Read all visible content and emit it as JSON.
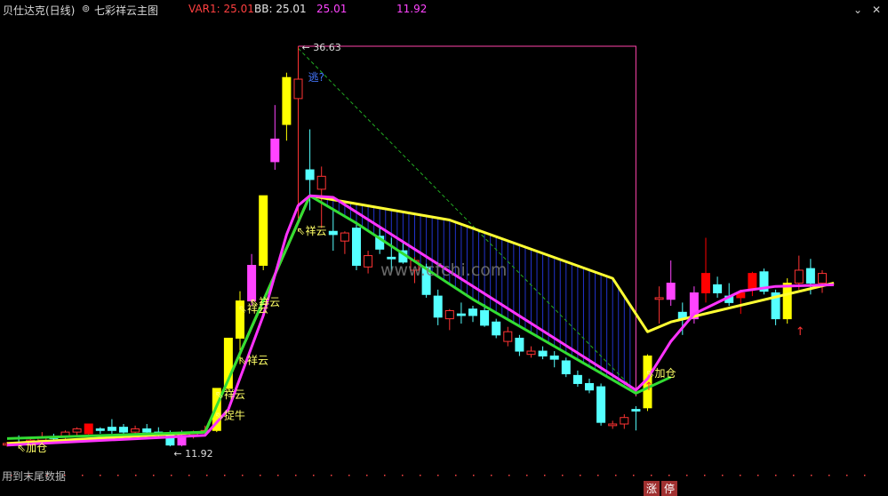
{
  "header": {
    "stock_label": "贝仕达克(日线)",
    "indicator_label": "七彩祥云主图",
    "var1_label": "VAR1: 25.01",
    "bb_label": "BB: 25.01",
    "plain_value": "25.01",
    "low_value": "11.92",
    "indicator_menu_icon": "circle-dropdown-icon",
    "settings_icon": "chevron-down-circle-icon",
    "close_icon": "close-x-icon",
    "colors": {
      "stock": "#d8d8d8",
      "var1": "#ff4040",
      "bb": "#e8e8e8",
      "value": "#ff44ff"
    }
  },
  "footer": {
    "hint_text": "用到末尾数据",
    "zhang_label": "涨",
    "ting_label": "停"
  },
  "watermark": "www.cfchi.com",
  "chart_data": {
    "type": "candlestick",
    "title": "七彩祥云主图",
    "ylim": [
      10.5,
      38.5
    ],
    "high_price": "36.63",
    "low_price": "11.92",
    "candles": [
      {
        "o": 12.0,
        "h": 12.2,
        "l": 11.9,
        "c": 12.1,
        "col": "#ff3333",
        "fill": false
      },
      {
        "o": 12.1,
        "h": 12.6,
        "l": 11.9,
        "c": 12.0,
        "col": "#55ffff",
        "fill": true
      },
      {
        "o": 12.0,
        "h": 12.4,
        "l": 11.9,
        "c": 12.3,
        "col": "#ff3333",
        "fill": false
      },
      {
        "o": 12.3,
        "h": 12.8,
        "l": 12.0,
        "c": 12.5,
        "col": "#ff3333",
        "fill": false
      },
      {
        "o": 12.4,
        "h": 12.7,
        "l": 12.1,
        "c": 12.5,
        "col": "#55ffff",
        "fill": true
      },
      {
        "o": 12.5,
        "h": 12.9,
        "l": 12.3,
        "c": 12.8,
        "col": "#ff3333",
        "fill": false
      },
      {
        "o": 12.8,
        "h": 13.1,
        "l": 12.6,
        "c": 13.0,
        "col": "#ff3333",
        "fill": false
      },
      {
        "o": 12.7,
        "h": 13.3,
        "l": 12.5,
        "c": 13.3,
        "col": "#ff0000",
        "fill": true
      },
      {
        "o": 13.0,
        "h": 13.1,
        "l": 12.7,
        "c": 12.9,
        "col": "#55ffff",
        "fill": true
      },
      {
        "o": 12.9,
        "h": 13.6,
        "l": 12.7,
        "c": 13.1,
        "col": "#55ffff",
        "fill": true
      },
      {
        "o": 13.1,
        "h": 13.3,
        "l": 12.6,
        "c": 12.8,
        "col": "#55ffff",
        "fill": true
      },
      {
        "o": 12.8,
        "h": 13.2,
        "l": 12.6,
        "c": 13.0,
        "col": "#ff3333",
        "fill": false
      },
      {
        "o": 13.0,
        "h": 13.3,
        "l": 12.7,
        "c": 12.8,
        "col": "#55ffff",
        "fill": true
      },
      {
        "o": 12.8,
        "h": 13.1,
        "l": 12.5,
        "c": 12.7,
        "col": "#55ffff",
        "fill": true
      },
      {
        "o": 12.7,
        "h": 12.9,
        "l": 11.92,
        "c": 12.0,
        "col": "#55ffff",
        "fill": true
      },
      {
        "o": 12.0,
        "h": 12.9,
        "l": 11.92,
        "c": 12.6,
        "col": "#ff44ff",
        "fill": true
      },
      {
        "o": 12.6,
        "h": 12.9,
        "l": 12.4,
        "c": 12.8,
        "col": "#ff3333",
        "fill": false
      },
      {
        "o": 12.8,
        "h": 13.2,
        "l": 12.6,
        "c": 12.9,
        "col": "#ff3333",
        "fill": false
      },
      {
        "o": 12.9,
        "h": 15.5,
        "l": 12.8,
        "c": 15.5,
        "col": "#ffff00",
        "fill": true
      },
      {
        "o": 15.5,
        "h": 18.6,
        "l": 15.3,
        "c": 18.6,
        "col": "#ffff00",
        "fill": true
      },
      {
        "o": 18.6,
        "h": 21.5,
        "l": 17.0,
        "c": 20.9,
        "col": "#ffff00",
        "fill": true
      },
      {
        "o": 20.9,
        "h": 23.8,
        "l": 20.6,
        "c": 23.1,
        "col": "#ff44ff",
        "fill": true
      },
      {
        "o": 23.1,
        "h": 27.4,
        "l": 22.8,
        "c": 27.4,
        "col": "#ffff00",
        "fill": true
      },
      {
        "o": 29.5,
        "h": 33.0,
        "l": 29.0,
        "c": 30.9,
        "col": "#ff44ff",
        "fill": true
      },
      {
        "o": 31.8,
        "h": 35.0,
        "l": 30.8,
        "c": 34.7,
        "col": "#ffff00",
        "fill": true
      },
      {
        "o": 34.6,
        "h": 36.63,
        "l": 26.0,
        "c": 33.4,
        "col": "#ff3333",
        "fill": false
      },
      {
        "o": 29.0,
        "h": 31.5,
        "l": 26.5,
        "c": 28.4,
        "col": "#55ffff",
        "fill": true
      },
      {
        "o": 27.8,
        "h": 29.2,
        "l": 25.4,
        "c": 28.6,
        "col": "#ff3333",
        "fill": false
      },
      {
        "o": 25.2,
        "h": 26.5,
        "l": 24.0,
        "c": 25.0,
        "col": "#55ffff",
        "fill": true
      },
      {
        "o": 24.6,
        "h": 25.2,
        "l": 23.8,
        "c": 25.1,
        "col": "#ff3333",
        "fill": false
      },
      {
        "o": 25.4,
        "h": 25.8,
        "l": 22.8,
        "c": 23.1,
        "col": "#55ffff",
        "fill": true
      },
      {
        "o": 23.0,
        "h": 24.0,
        "l": 22.6,
        "c": 23.7,
        "col": "#ff3333",
        "fill": false
      },
      {
        "o": 24.9,
        "h": 25.4,
        "l": 23.8,
        "c": 24.1,
        "col": "#55ffff",
        "fill": true
      },
      {
        "o": 23.6,
        "h": 24.8,
        "l": 22.7,
        "c": 23.5,
        "col": "#55ffff",
        "fill": true
      },
      {
        "o": 24.0,
        "h": 24.6,
        "l": 23.2,
        "c": 23.3,
        "col": "#55ffff",
        "fill": true
      },
      {
        "o": 22.8,
        "h": 23.6,
        "l": 22.0,
        "c": 23.4,
        "col": "#ff3333",
        "fill": false
      },
      {
        "o": 23.0,
        "h": 23.2,
        "l": 21.1,
        "c": 21.3,
        "col": "#55ffff",
        "fill": true
      },
      {
        "o": 21.2,
        "h": 21.6,
        "l": 19.4,
        "c": 19.9,
        "col": "#55ffff",
        "fill": true
      },
      {
        "o": 19.8,
        "h": 20.4,
        "l": 19.1,
        "c": 20.3,
        "col": "#ff3333",
        "fill": false
      },
      {
        "o": 20.1,
        "h": 20.8,
        "l": 19.5,
        "c": 20.0,
        "col": "#55ffff",
        "fill": true
      },
      {
        "o": 20.0,
        "h": 20.6,
        "l": 19.6,
        "c": 20.4,
        "col": "#55ffff",
        "fill": true
      },
      {
        "o": 20.3,
        "h": 20.7,
        "l": 19.3,
        "c": 19.4,
        "col": "#55ffff",
        "fill": true
      },
      {
        "o": 19.6,
        "h": 19.8,
        "l": 18.6,
        "c": 18.8,
        "col": "#55ffff",
        "fill": true
      },
      {
        "o": 19.0,
        "h": 19.3,
        "l": 18.1,
        "c": 18.4,
        "col": "#ff3333",
        "fill": false
      },
      {
        "o": 18.6,
        "h": 18.8,
        "l": 17.5,
        "c": 17.8,
        "col": "#55ffff",
        "fill": true
      },
      {
        "o": 17.8,
        "h": 18.1,
        "l": 17.4,
        "c": 17.6,
        "col": "#ff3333",
        "fill": false
      },
      {
        "o": 17.8,
        "h": 18.1,
        "l": 17.3,
        "c": 17.5,
        "col": "#55ffff",
        "fill": true
      },
      {
        "o": 17.5,
        "h": 17.8,
        "l": 16.8,
        "c": 17.3,
        "col": "#55ffff",
        "fill": true
      },
      {
        "o": 17.2,
        "h": 17.4,
        "l": 16.2,
        "c": 16.4,
        "col": "#55ffff",
        "fill": true
      },
      {
        "o": 16.3,
        "h": 16.6,
        "l": 15.6,
        "c": 15.8,
        "col": "#55ffff",
        "fill": true
      },
      {
        "o": 15.8,
        "h": 16.1,
        "l": 15.2,
        "c": 15.4,
        "col": "#55ffff",
        "fill": true
      },
      {
        "o": 15.6,
        "h": 15.8,
        "l": 13.2,
        "c": 13.4,
        "col": "#55ffff",
        "fill": true
      },
      {
        "o": 13.2,
        "h": 13.5,
        "l": 13.0,
        "c": 13.3,
        "col": "#ff3333",
        "fill": false
      },
      {
        "o": 13.3,
        "h": 13.9,
        "l": 13.0,
        "c": 13.7,
        "col": "#ff3333",
        "fill": false
      },
      {
        "o": 14.2,
        "h": 14.4,
        "l": 12.9,
        "c": 14.1,
        "col": "#55ffff",
        "fill": true
      },
      {
        "o": 14.3,
        "h": 17.6,
        "l": 14.1,
        "c": 17.5,
        "col": "#ffff00",
        "fill": true
      },
      {
        "o": 21.0,
        "h": 21.8,
        "l": 19.5,
        "c": 21.1,
        "col": "#ff3333",
        "fill": false
      },
      {
        "o": 21.0,
        "h": 23.4,
        "l": 20.6,
        "c": 22.0,
        "col": "#ff44ff",
        "fill": true
      },
      {
        "o": 20.2,
        "h": 20.8,
        "l": 18.8,
        "c": 19.8,
        "col": "#55ffff",
        "fill": true
      },
      {
        "o": 19.8,
        "h": 21.8,
        "l": 19.5,
        "c": 21.4,
        "col": "#ff44ff",
        "fill": true
      },
      {
        "o": 21.4,
        "h": 24.8,
        "l": 20.8,
        "c": 22.6,
        "col": "#ff0000",
        "fill": true
      },
      {
        "o": 21.9,
        "h": 22.4,
        "l": 21.1,
        "c": 21.4,
        "col": "#55ffff",
        "fill": true
      },
      {
        "o": 21.2,
        "h": 22.0,
        "l": 20.6,
        "c": 20.8,
        "col": "#55ffff",
        "fill": true
      },
      {
        "o": 21.1,
        "h": 21.6,
        "l": 20.1,
        "c": 21.4,
        "col": "#ff0000",
        "fill": true
      },
      {
        "o": 21.6,
        "h": 22.7,
        "l": 21.2,
        "c": 22.6,
        "col": "#ff0000",
        "fill": true
      },
      {
        "o": 22.7,
        "h": 22.9,
        "l": 21.3,
        "c": 21.5,
        "col": "#55ffff",
        "fill": true
      },
      {
        "o": 21.4,
        "h": 21.6,
        "l": 19.4,
        "c": 19.8,
        "col": "#55ffff",
        "fill": true
      },
      {
        "o": 19.8,
        "h": 22.3,
        "l": 19.5,
        "c": 22.0,
        "col": "#ffff00",
        "fill": true
      },
      {
        "o": 22.0,
        "h": 23.7,
        "l": 21.6,
        "c": 22.8,
        "col": "#ff3333",
        "fill": false
      },
      {
        "o": 22.9,
        "h": 23.5,
        "l": 21.3,
        "c": 22.0,
        "col": "#55ffff",
        "fill": true
      },
      {
        "o": 22.0,
        "h": 22.8,
        "l": 21.4,
        "c": 22.6,
        "col": "#ff3333",
        "fill": false
      }
    ],
    "lines": [
      {
        "name": "yellow",
        "color": "#ffff33",
        "points": [
          [
            0,
            12.1
          ],
          [
            17,
            12.8
          ],
          [
            26,
            27.4
          ],
          [
            38,
            25.9
          ],
          [
            52,
            22.3
          ],
          [
            55,
            19.0
          ],
          [
            57,
            19.6
          ],
          [
            71,
            22.0
          ]
        ]
      },
      {
        "name": "green",
        "color": "#33dd33",
        "points": [
          [
            0,
            12.4
          ],
          [
            17,
            12.8
          ],
          [
            26,
            27.4
          ],
          [
            30,
            25.7
          ],
          [
            40,
            21.0
          ],
          [
            54,
            15.2
          ],
          [
            57,
            16.2
          ]
        ]
      },
      {
        "name": "magenta",
        "color": "#ff33ff",
        "points": [
          [
            0,
            12.0
          ],
          [
            17,
            12.6
          ],
          [
            19,
            14.2
          ],
          [
            22,
            20.0
          ],
          [
            24,
            25.0
          ],
          [
            25,
            26.8
          ],
          [
            26,
            27.4
          ],
          [
            28,
            27.3
          ],
          [
            54,
            15.4
          ],
          [
            55,
            16.1
          ],
          [
            57,
            18.4
          ],
          [
            59,
            20.1
          ],
          [
            63,
            21.5
          ],
          [
            66,
            21.8
          ],
          [
            71,
            21.9
          ]
        ]
      }
    ],
    "annotations": [
      {
        "text": "⇖祥云",
        "i": 25,
        "p": 25.0,
        "color": "#ffff66"
      },
      {
        "text": "⇖祥云",
        "i": 21,
        "p": 20.6,
        "color": "#ffff66"
      },
      {
        "text": "⇖祥云",
        "i": 20,
        "p": 20.2,
        "color": "#ffff66"
      },
      {
        "text": "⇖祥云",
        "i": 20,
        "p": 17.0,
        "color": "#ffff66"
      },
      {
        "text": "⇖祥云",
        "i": 18,
        "p": 14.9,
        "color": "#ffff66"
      },
      {
        "text": "⇖捉牛",
        "i": 18,
        "p": 13.6,
        "color": "#ffff66"
      },
      {
        "text": "⇖加仓",
        "i": 1,
        "p": 11.6,
        "color": "#ffff66"
      },
      {
        "text": "⇖加仓",
        "i": 55,
        "p": 16.2,
        "color": "#ffff66"
      },
      {
        "text": "逃?",
        "i": 26,
        "p": 34.5,
        "color": "#4477ff"
      }
    ],
    "arrows": [
      {
        "i": 55,
        "p": 15.4
      },
      {
        "i": 68,
        "p": 18.8
      }
    ],
    "peak_line": {
      "i_start": 25,
      "i_end": 54
    },
    "trend_line": {
      "from": [
        25,
        36.5
      ],
      "to": [
        54,
        15.3
      ]
    }
  }
}
